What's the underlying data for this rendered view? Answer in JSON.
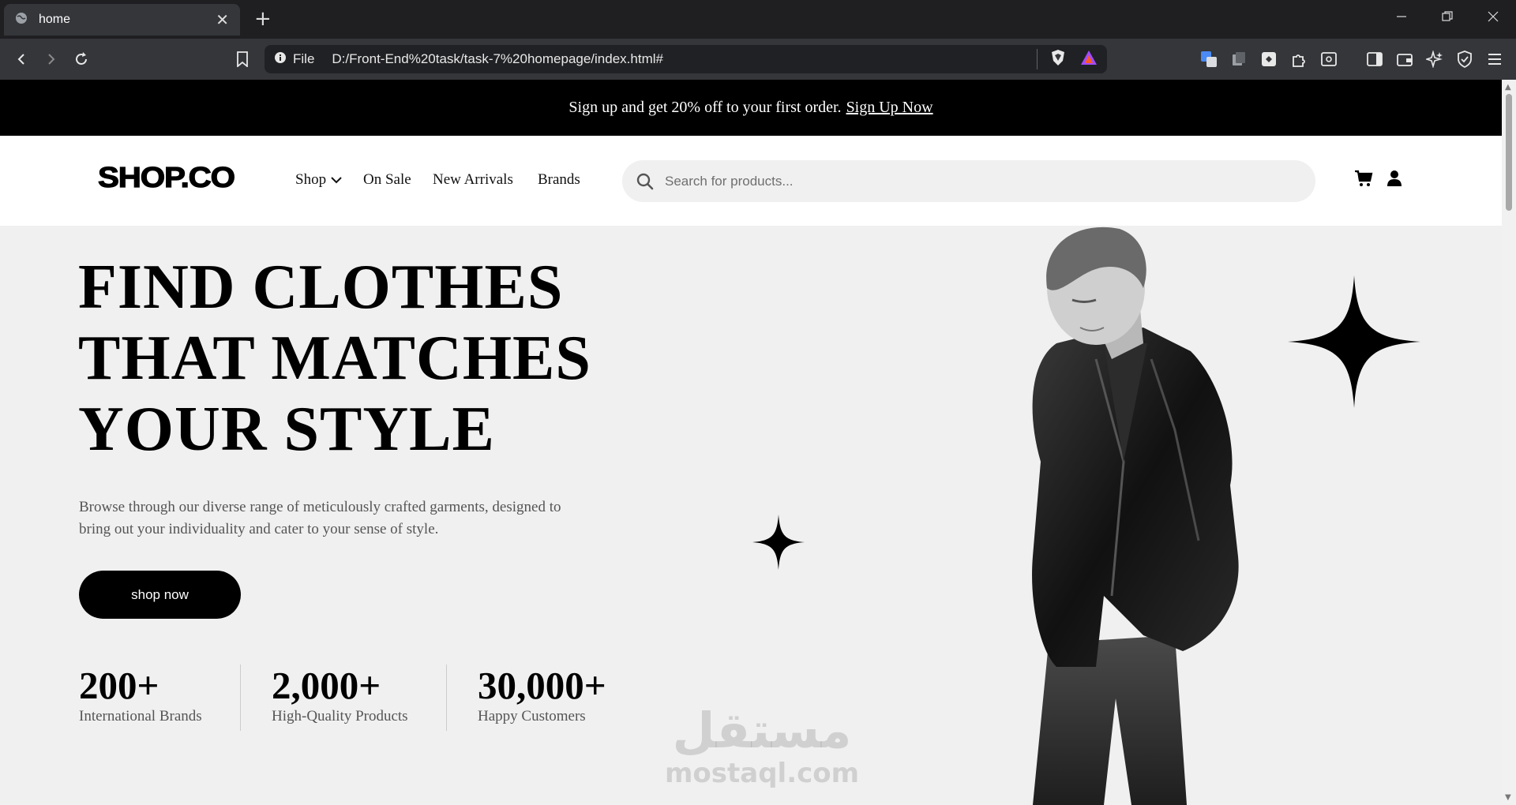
{
  "browser": {
    "tab_title": "home",
    "new_tab": "+",
    "close": "✕",
    "file_label": "File",
    "url": "D:/Front-End%20task/task-7%20homepage/index.html#"
  },
  "promo": {
    "text": "Sign up and get 20% off to your first order.",
    "link": "Sign Up Now"
  },
  "header": {
    "logo": "SHOP.CO",
    "nav": [
      "Shop",
      "On Sale",
      "New Arrivals",
      "Brands"
    ],
    "search_placeholder": "Search for products..."
  },
  "hero": {
    "title_lines": [
      "FIND CLOTHES",
      "THAT MATCHES",
      "YOUR STYLE"
    ],
    "description_lines": [
      "Browse through our diverse range of meticulously crafted garments, designed to",
      "bring out your individuality and cater to your sense of style."
    ],
    "button": "shop now",
    "stats": [
      {
        "value": "200+",
        "label": "International Brands"
      },
      {
        "value": "2,000+",
        "label": "High-Quality Products"
      },
      {
        "value": "30,000+",
        "label": "Happy Customers"
      }
    ]
  },
  "watermark": {
    "arabic": "مستقل",
    "latin": "mostaql.com"
  },
  "icons": [
    "globe-icon",
    "back-icon",
    "forward-icon",
    "reload-icon",
    "bookmark-icon",
    "info-icon",
    "brave-shield-icon",
    "brave-rewards-icon",
    "translate-icon",
    "extension-icon",
    "puzzle-icon",
    "sidebar-icon",
    "wallet-icon",
    "leo-icon",
    "vpn-icon",
    "menu-icon",
    "search-icon",
    "cart-icon",
    "user-icon",
    "chevron-down-icon",
    "sparkle-icon"
  ]
}
